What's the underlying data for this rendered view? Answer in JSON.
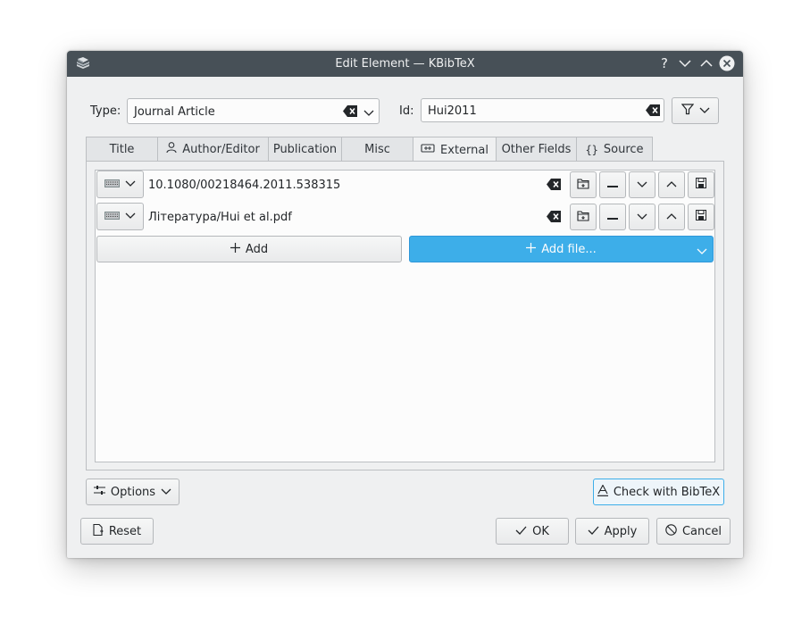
{
  "window": {
    "title": "Edit Element — KBibTeX",
    "icons": [
      "app-icon",
      "help-icon",
      "minimize-icon",
      "maximize-icon",
      "close-icon"
    ]
  },
  "type_row": {
    "type_label": "Type:",
    "type_value": "Journal Article",
    "id_label": "Id:",
    "id_value": "Hui2011"
  },
  "tabs": [
    {
      "label": "Title",
      "icon": ""
    },
    {
      "label": "Author/Editor",
      "icon": "person-icon"
    },
    {
      "label": "Publication",
      "icon": ""
    },
    {
      "label": "Misc",
      "icon": ""
    },
    {
      "label": "External",
      "icon": "link-icon",
      "active": true
    },
    {
      "label": "Other Fields",
      "icon": ""
    },
    {
      "label": "Source",
      "icon": "braces-icon"
    }
  ],
  "external": {
    "rows": [
      {
        "value": "10.1080/00218464.2011.538315"
      },
      {
        "value": "Література/Hui et al.pdf"
      }
    ],
    "add_label": "Add",
    "add_file_label": "Add file..."
  },
  "options_label": "Options",
  "check_label": "Check with BibTeX",
  "reset_label": "Reset",
  "ok_label": "OK",
  "apply_label": "Apply",
  "cancel_label": "Cancel",
  "colors": {
    "titlebar": "#475057",
    "accent": "#3daee9",
    "background": "#eff0f1"
  }
}
